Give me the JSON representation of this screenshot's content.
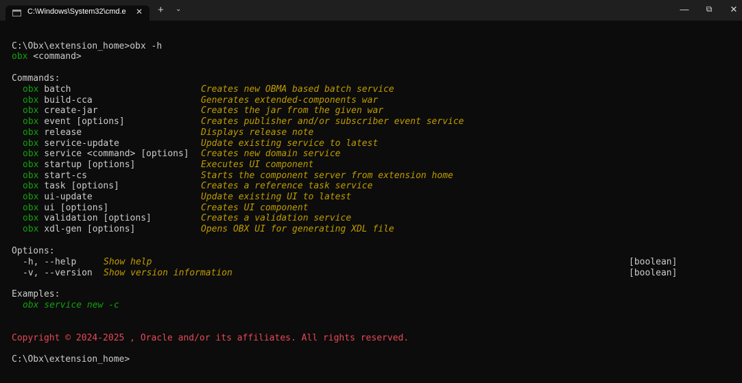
{
  "window": {
    "tab_title": "C:\\Windows\\System32\\cmd.e",
    "tab_close": "✕",
    "new_tab": "+",
    "dropdown": "⌄",
    "minimize": "—",
    "maximize": "⧉",
    "close": "✕"
  },
  "terminal": {
    "prompt1": "C:\\Obx\\extension_home>",
    "command1": "obx -h",
    "usage_prefix": "obx",
    "usage_rest": " <command>",
    "commands_header": "Commands:",
    "commands": [
      {
        "prefix": "obx",
        "name": " batch",
        "desc": "Creates new OBMA based batch service"
      },
      {
        "prefix": "obx",
        "name": " build-cca",
        "desc": "Generates extended-components war"
      },
      {
        "prefix": "obx",
        "name": " create-jar",
        "desc": "Creates the jar from the given war"
      },
      {
        "prefix": "obx",
        "name": " event [options]",
        "desc": "Creates publisher and/or subscriber event service"
      },
      {
        "prefix": "obx",
        "name": " release",
        "desc": "Displays release note"
      },
      {
        "prefix": "obx",
        "name": " service-update",
        "desc": "Update existing service to latest"
      },
      {
        "prefix": "obx",
        "name": " service <command> [options]",
        "desc": "Creates new domain service"
      },
      {
        "prefix": "obx",
        "name": " startup [options]",
        "desc": "Executes UI component"
      },
      {
        "prefix": "obx",
        "name": " start-cs",
        "desc": "Starts the component server from extension home"
      },
      {
        "prefix": "obx",
        "name": " task [options]",
        "desc": "Creates a reference task service"
      },
      {
        "prefix": "obx",
        "name": " ui-update",
        "desc": "Update existing UI to latest"
      },
      {
        "prefix": "obx",
        "name": " ui [options]",
        "desc": "Creates UI component"
      },
      {
        "prefix": "obx",
        "name": " validation [options]",
        "desc": "Creates a validation service"
      },
      {
        "prefix": "obx",
        "name": " xdl-gen [options]",
        "desc": "Opens OBX UI for generating XDL file"
      }
    ],
    "options_header": "Options:",
    "options": [
      {
        "flag": "-h, --help",
        "desc": "Show help",
        "type": "[boolean]"
      },
      {
        "flag": "-v, --version",
        "desc": "Show version information",
        "type": "[boolean]"
      }
    ],
    "examples_header": "Examples:",
    "example": "obx service new -c",
    "copyright": "Copyright © 2024-2025 , Oracle and/or its affiliates. All rights reserved.",
    "prompt2": "C:\\Obx\\extension_home>"
  },
  "colors": {
    "background": "#0c0c0c",
    "foreground": "#cccccc",
    "green": "#13a10e",
    "yellow": "#c19c00",
    "red": "#e74856"
  }
}
